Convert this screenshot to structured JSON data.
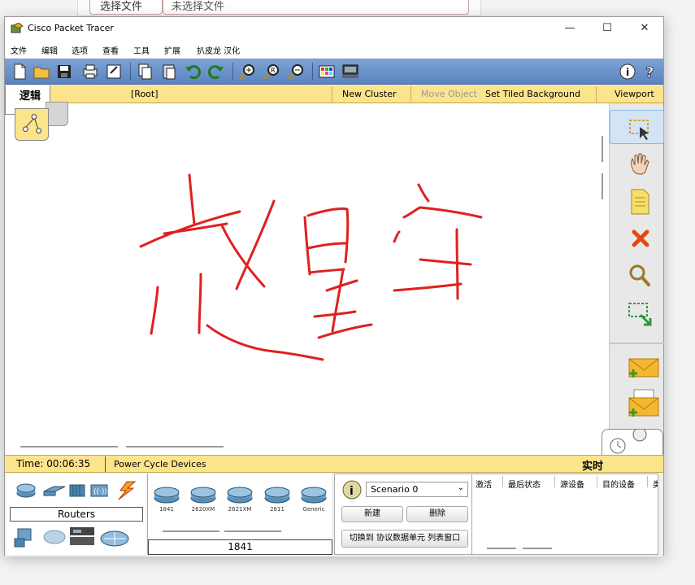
{
  "background": {
    "file_button": "选择文件",
    "file_status": "未选择文件"
  },
  "window": {
    "title": "Cisco Packet Tracer",
    "controls": {
      "minimize": "—",
      "maximize": "☐",
      "close": "✕"
    }
  },
  "menu": [
    "文件",
    "编辑",
    "选项",
    "查看",
    "工具",
    "扩展",
    "扒皮龙 汉化"
  ],
  "workspace_bar": {
    "logic_tab": "逻辑",
    "root": "[Root]",
    "new_cluster": "New Cluster",
    "move_object": "Move Object",
    "set_tiled_background": "Set Tiled Background",
    "viewport": "Viewport"
  },
  "canvas": {
    "handwriting": "赵星宇",
    "stroke_color": "#e02020"
  },
  "status_bar": {
    "time": "Time: 00:06:35",
    "power_cycle": "Power Cycle Devices",
    "realtime": "实时"
  },
  "device_panel": {
    "category_label": "Routers",
    "selected_device": "1841",
    "devices": [
      "1841",
      "2620XM",
      "2621XM",
      "2811",
      "Generic"
    ]
  },
  "scenario": {
    "selected": "Scenario 0",
    "new_button": "新建",
    "delete_button": "删除",
    "toggle_button": "切换到 协议数据单元 列表窗口"
  },
  "pdu_table": {
    "headers": [
      "激活",
      "最后状态",
      "源设备",
      "目的设备",
      "类"
    ]
  },
  "colors": {
    "toolbar": "#6a92c9",
    "yellow_bar": "#fbe48b",
    "selected_tool": "#d2e4f6"
  }
}
